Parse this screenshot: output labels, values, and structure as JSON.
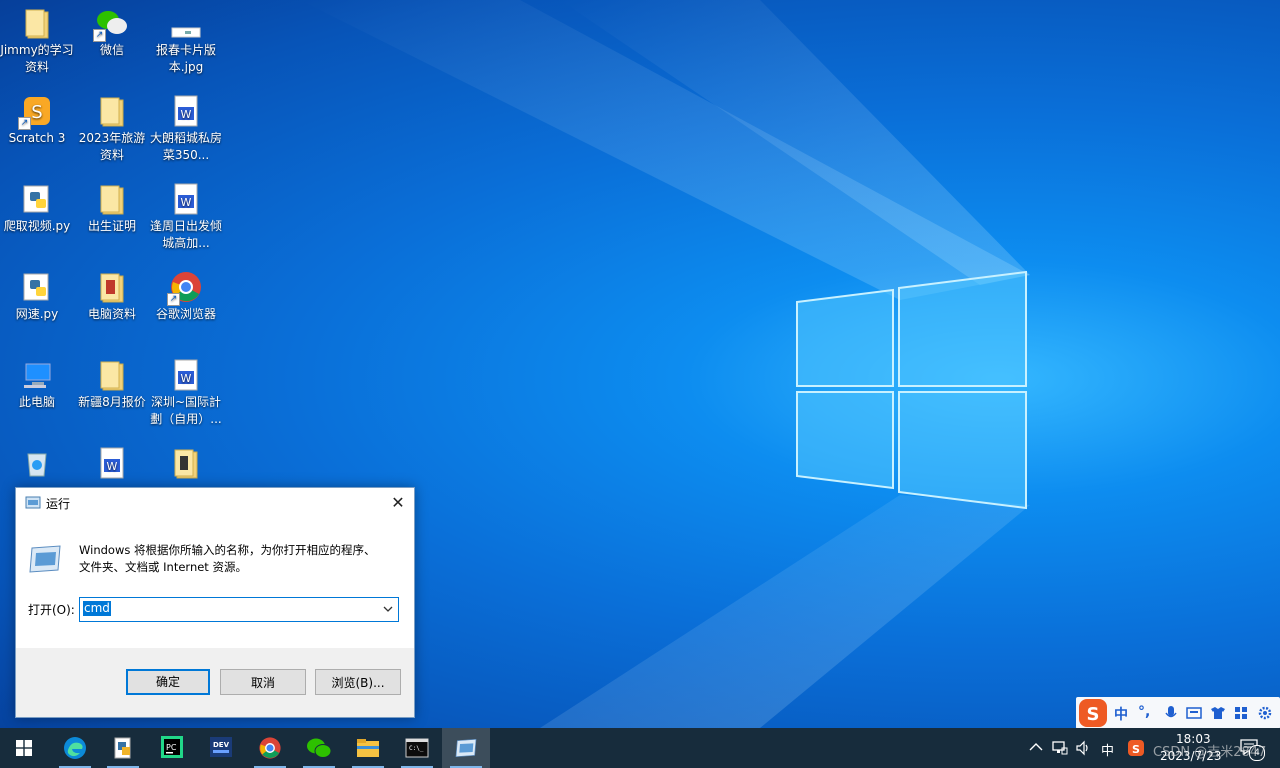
{
  "desktop": {
    "icons": [
      {
        "label": "Jimmy的学习资料",
        "icon": "folder-icon"
      },
      {
        "label": "微信",
        "icon": "wechat-icon"
      },
      {
        "label": "报春卡片版本.jpg",
        "icon": "image-file-icon"
      },
      {
        "label": "Scratch 3",
        "icon": "scratch-icon"
      },
      {
        "label": "2023年旅游资料",
        "icon": "folder-icon"
      },
      {
        "label": "大朗稻城私房菜350...",
        "icon": "word-doc-icon"
      },
      {
        "label": "爬取视频.py",
        "icon": "python-file-icon"
      },
      {
        "label": "出生证明",
        "icon": "folder-icon"
      },
      {
        "label": "逢周日出发倾城高加...",
        "icon": "word-doc-icon"
      },
      {
        "label": "网速.py",
        "icon": "python-file-icon"
      },
      {
        "label": "电脑资料",
        "icon": "folder-icon"
      },
      {
        "label": "谷歌浏览器",
        "icon": "chrome-icon"
      },
      {
        "label": "此电脑",
        "icon": "this-pc-icon"
      },
      {
        "label": "新疆8月报价",
        "icon": "folder-icon"
      },
      {
        "label": "深圳~国际計劃（自用）...",
        "icon": "word-doc-icon"
      },
      {
        "label": "",
        "icon": "recycle-bin-icon"
      },
      {
        "label": "",
        "icon": "word-doc-icon"
      },
      {
        "label": "",
        "icon": "folder-icon"
      }
    ]
  },
  "run_dialog": {
    "title": "运行",
    "description_line1": "Windows 将根据你所输入的名称，为你打开相应的程序、",
    "description_line2": "文件夹、文档或 Internet 资源。",
    "open_label": "打开(O):",
    "open_value": "cmd",
    "ok_label": "确定",
    "cancel_label": "取消",
    "browse_label": "浏览(B)..."
  },
  "taskbar": {
    "apps": [
      {
        "name": "start-button"
      },
      {
        "name": "edge-icon"
      },
      {
        "name": "file-manager-icon"
      },
      {
        "name": "pycharm-icon"
      },
      {
        "name": "devcpp-icon"
      },
      {
        "name": "chrome-icon"
      },
      {
        "name": "wechat-icon"
      },
      {
        "name": "file-explorer-icon"
      },
      {
        "name": "terminal-icon"
      },
      {
        "name": "run-dialog-icon"
      }
    ],
    "ime_indicator": "中",
    "time": "18:03",
    "date": "2023/7/23",
    "notification_count": "4"
  },
  "ime_toolbar": {
    "mode": "中",
    "punct": "°,"
  },
  "watermark": "CSDN @吉米2847",
  "colors": {
    "accent": "#0078d7",
    "taskbar": "#172c3c",
    "desktop": "#0a6fd8"
  }
}
